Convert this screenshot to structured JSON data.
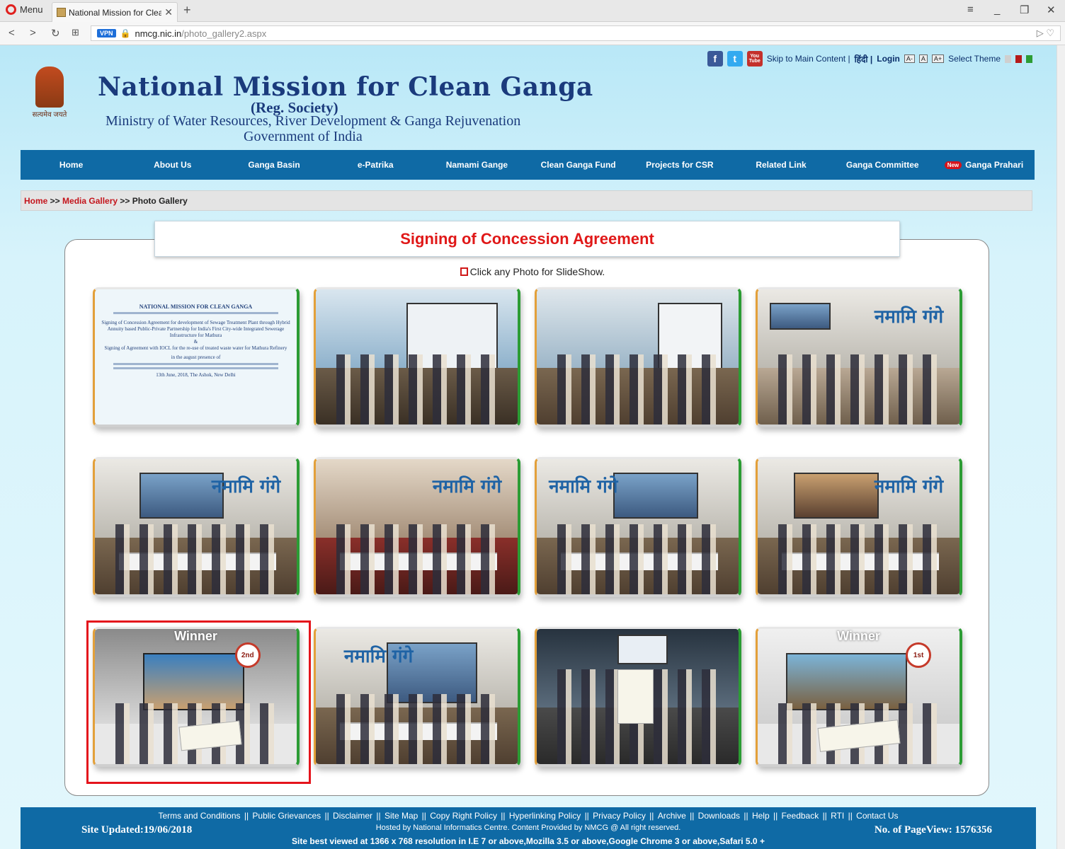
{
  "browser": {
    "menu_label": "Menu",
    "tab_title": "National Mission for Clean",
    "url_host": "nmcg.nic.in",
    "url_path": "/photo_gallery2.aspx",
    "vpn_label": "VPN"
  },
  "header": {
    "skip_link": "Skip to Main Content |",
    "hindi_link": "हिंदी |",
    "login_link": "Login",
    "font_small": "A-",
    "font_normal": "A",
    "font_large": "A+",
    "select_theme": "Select Theme",
    "theme_colors": [
      "#cfcfcf",
      "#b51a1a",
      "#2c9c34"
    ],
    "emblem_motto": "सत्यमेव जयते",
    "title": "National Mission for Clean Ganga",
    "subtitle": "(Reg. Society)",
    "ministry": "Ministry of Water Resources, River Development & Ganga Rejuvenation",
    "government": "Government of India"
  },
  "nav": {
    "items": [
      "Home",
      "About Us",
      "Ganga Basin",
      "e-Patrika",
      "Namami Gange",
      "Clean Ganga Fund",
      "Projects for CSR",
      "Related Link",
      "Ganga Committee"
    ],
    "new_badge": "New",
    "last_item": "Ganga Prahari"
  },
  "breadcrumb": {
    "home": "Home",
    "sep1": " >> ",
    "media": "Media Gallery",
    "sep2": " >> ",
    "current": "Photo Gallery"
  },
  "gallery": {
    "title": "Signing of Concession Agreement",
    "hint": "Click any Photo for SlideShow.",
    "doc": {
      "org": "NATIONAL MISSION FOR CLEAN GANGA",
      "line1": "Signing of Concession Agreement for development of Sewage Treatment Plant through Hybrid Annuity based Public-Private Partnership for India's First City-wide Integrated Sewerage Infrastructure for Mathura",
      "amp": "&",
      "line2": "Signing of Agreement with IOCL for the re-use of treated waste water for Mathura Refinery",
      "presence": "in the august presence of",
      "date": "13th June, 2018, The Ashok, New Delhi"
    },
    "namami_text": "नमामि गंगे",
    "winner_label": "Winner",
    "prize_2": "2nd",
    "prize_1": "1st"
  },
  "footer": {
    "links": [
      "Terms and Conditions",
      "Public Grievances",
      "Disclaimer",
      "Site Map",
      "Copy Right Policy",
      "Hyperlinking Policy",
      "Privacy Policy",
      "Archive",
      "Downloads",
      "Help",
      "Feedback",
      "RTI",
      "Contact Us"
    ],
    "site_updated": "Site Updated:19/06/2018",
    "hosted": "Hosted by National Informatics Centre. Content Provided by NMCG @ All right reserved.",
    "best_viewed": "Site best viewed at 1366 x 768 resolution in I.E 7 or above,Mozilla 3.5 or above,Google Chrome 3 or above,Safari 5.0 +",
    "page_views": "No. of PageView: 1576356"
  }
}
